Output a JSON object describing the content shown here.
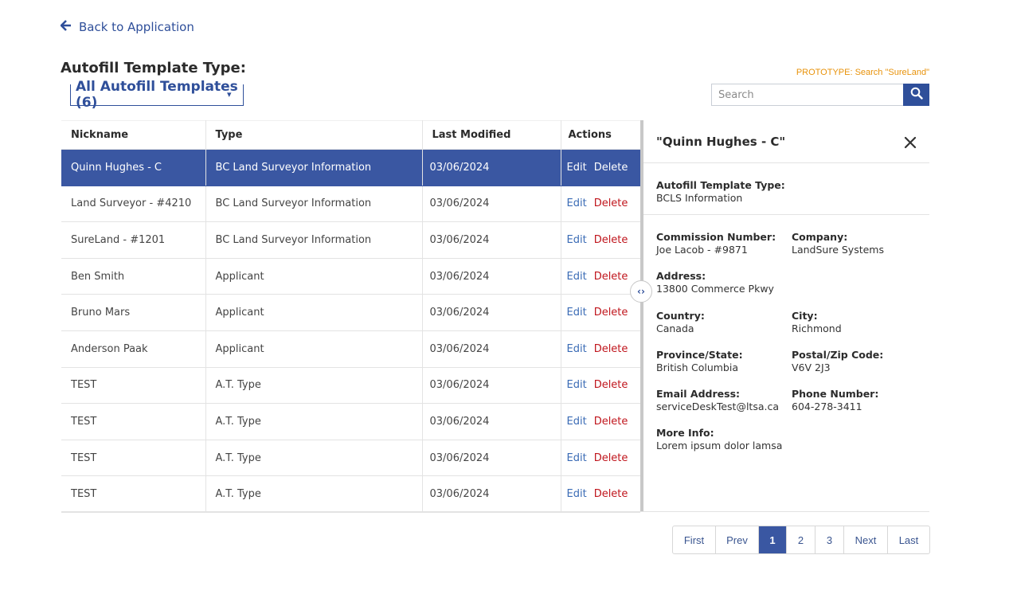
{
  "nav": {
    "back_label": "Back to Application"
  },
  "filter": {
    "label": "Autofill Template Type:",
    "selected": "All Autofill Templates (6)"
  },
  "search": {
    "prototype_note": "PROTOTYPE: Search \"SureLand\"",
    "placeholder": "Search"
  },
  "table": {
    "headers": [
      "Nickname",
      "Type",
      "Last Modified",
      "Actions"
    ],
    "edit_label": "Edit",
    "delete_label": "Delete",
    "rows": [
      {
        "nickname": "Quinn Hughes - C",
        "type": "BC Land Surveyor Information",
        "modified": "03/06/2024",
        "selected": true
      },
      {
        "nickname": "Land Surveyor - #4210",
        "type": "BC Land Surveyor Information",
        "modified": "03/06/2024"
      },
      {
        "nickname": "SureLand - #1201",
        "type": "BC Land Surveyor Information",
        "modified": "03/06/2024"
      },
      {
        "nickname": "Ben Smith",
        "type": "Applicant",
        "modified": "03/06/2024"
      },
      {
        "nickname": "Bruno Mars",
        "type": "Applicant",
        "modified": "03/06/2024"
      },
      {
        "nickname": "Anderson Paak",
        "type": "Applicant",
        "modified": "03/06/2024"
      },
      {
        "nickname": "TEST",
        "type": "A.T. Type",
        "modified": "03/06/2024"
      },
      {
        "nickname": "TEST",
        "type": "A.T. Type",
        "modified": "03/06/2024"
      },
      {
        "nickname": "TEST",
        "type": "A.T. Type",
        "modified": "03/06/2024"
      },
      {
        "nickname": "TEST",
        "type": "A.T. Type",
        "modified": "03/06/2024"
      }
    ]
  },
  "detail": {
    "title": "\"Quinn Hughes - C\"",
    "template_type_label": "Autofill Template Type:",
    "template_type_value": "BCLS Information",
    "commission_label": "Commission Number:",
    "commission_value": "Joe Lacob - #9871",
    "company_label": "Company:",
    "company_value": "LandSure Systems",
    "address_label": "Address:",
    "address_value": "13800 Commerce Pkwy",
    "country_label": "Country:",
    "country_value": "Canada",
    "city_label": "City:",
    "city_value": "Richmond",
    "province_label": "Province/State:",
    "province_value": "British Columbia",
    "postal_label": "Postal/Zip Code:",
    "postal_value": "V6V 2J3",
    "email_label": "Email Address:",
    "email_value": "serviceDeskTest@ltsa.ca",
    "phone_label": "Phone Number:",
    "phone_value": "604-278-3411",
    "info_label": "More Info:",
    "info_value": "Lorem ipsum dolor lamsa"
  },
  "pagination": {
    "first": "First",
    "prev": "Prev",
    "pages": [
      "1",
      "2",
      "3"
    ],
    "current": "1",
    "next": "Next",
    "last": "Last"
  },
  "colors": {
    "primary": "#3a57a2",
    "link": "#2f4f9a",
    "danger": "#c0161d",
    "note": "#e8920a"
  },
  "icons": [
    "arrow-left-icon",
    "caret-down-icon",
    "search-icon",
    "close-icon",
    "chevron-left-right-icon"
  ]
}
